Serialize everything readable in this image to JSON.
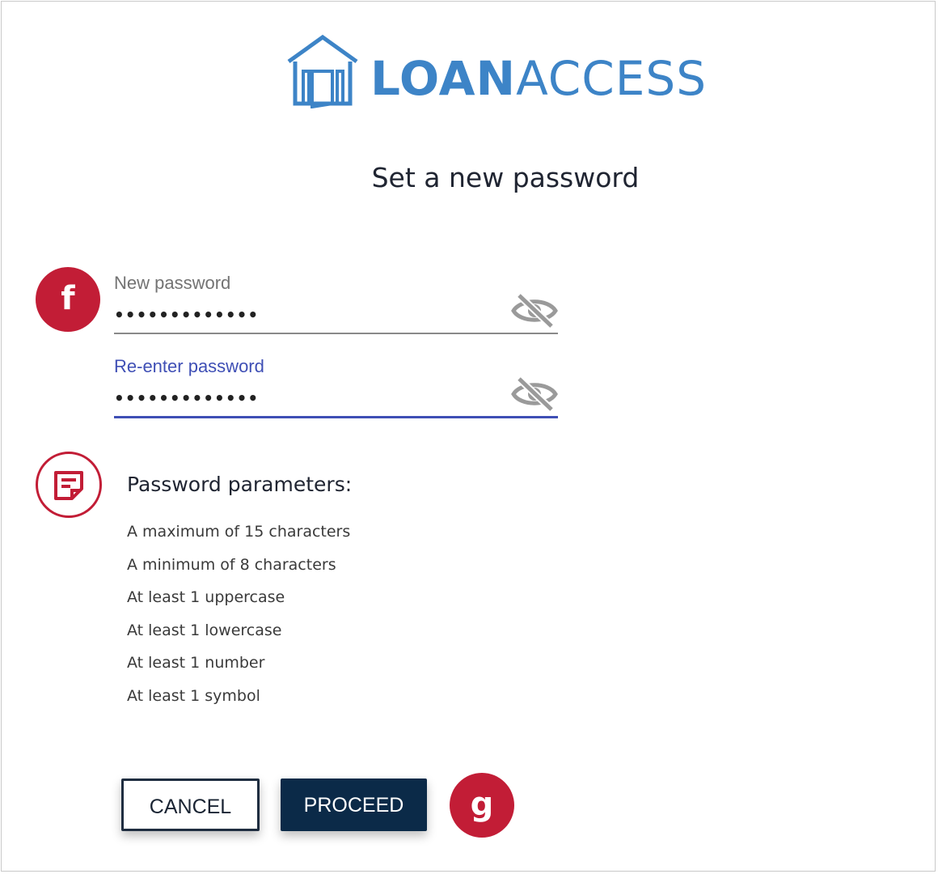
{
  "logo": {
    "word_bold": "LOAN",
    "word_light": "ACCESS",
    "color": "#3d84c7"
  },
  "page": {
    "title": "Set a new password"
  },
  "badges": {
    "f": "f",
    "g": "g",
    "note_icon": "note-icon"
  },
  "fields": {
    "new_password": {
      "label": "New password",
      "value": "•••••••••••••",
      "toggle_icon": "eye-slash-icon"
    },
    "reenter_password": {
      "label": "Re-enter password",
      "value": "•••••••••••••",
      "toggle_icon": "eye-slash-icon"
    }
  },
  "params": {
    "title": "Password parameters:",
    "items": [
      "A maximum of 15 characters",
      "A minimum of 8 characters",
      "At least 1 uppercase",
      "At least 1 lowercase",
      "At least 1 number",
      "At least 1 symbol"
    ]
  },
  "buttons": {
    "cancel": "CANCEL",
    "proceed": "PROCEED"
  },
  "colors": {
    "accent_red": "#c21d36",
    "focus_blue": "#3f4fb5",
    "primary_navy": "#0b2a48"
  }
}
